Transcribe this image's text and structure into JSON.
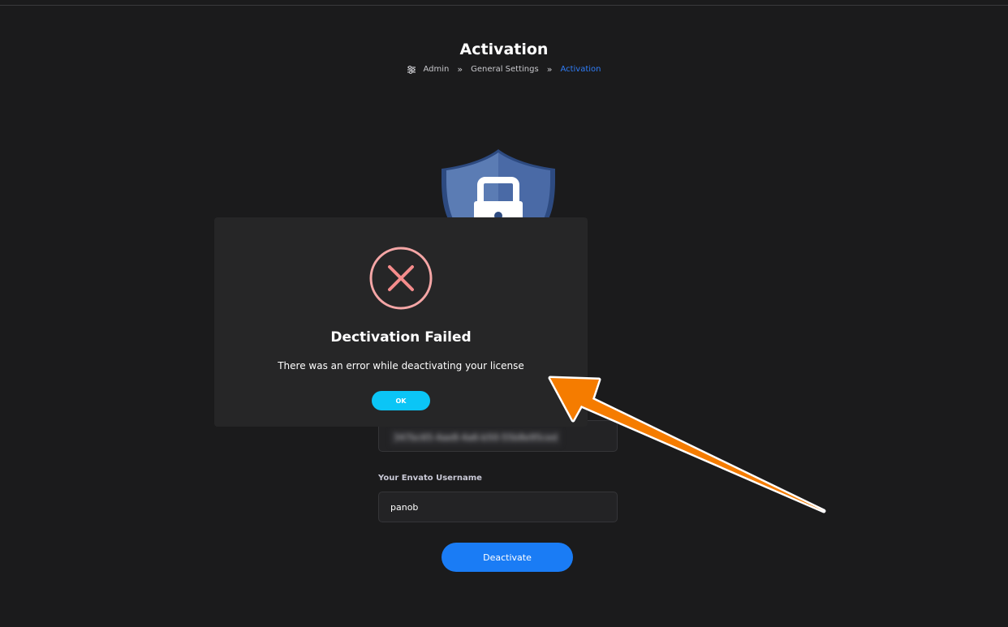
{
  "header": {
    "title": "Activation",
    "breadcrumb": {
      "icon": "sliders-icon",
      "items": [
        "Admin",
        "General Settings",
        "Activation"
      ],
      "separator": "»"
    }
  },
  "form": {
    "purchase_code_value": "347bc65-4ae8-4a6-b50-55b8e95ced",
    "username_label": "Your Envato Username",
    "username_value": "panob",
    "deactivate_label": "Deactivate"
  },
  "dialog": {
    "icon": "error-x-icon",
    "title": "Dectivation Failed",
    "message": "There was an error while deactivating your license",
    "ok_label": "OK"
  },
  "colors": {
    "background": "#1b1b1c",
    "accent": "#1a7cf5",
    "breadcrumb_active": "#2f7cf6",
    "ok_button": "#0bc5f6",
    "error": "#f5a6a6",
    "annotation_arrow": "#f57c00"
  }
}
